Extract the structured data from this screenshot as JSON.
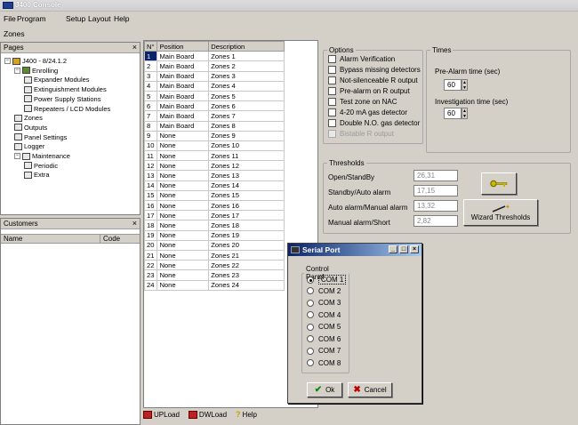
{
  "window": {
    "title": "J400 Console"
  },
  "menu": [
    "File",
    "Program",
    "Setup",
    "Layout",
    "Help"
  ],
  "toolbar": {
    "section": "Zones"
  },
  "pages_panel": {
    "title": "Pages",
    "close": "×",
    "tree": [
      {
        "label": "J400 - 8/24.1.2",
        "depth": 0,
        "expander": "−",
        "icon": "server-icon"
      },
      {
        "label": "Enrolling",
        "depth": 1,
        "expander": "−",
        "icon": "enrolling-icon"
      },
      {
        "label": "Expander Modules",
        "depth": 2,
        "icon": "expander-icon"
      },
      {
        "label": "Extinguishment Modules",
        "depth": 2,
        "icon": "extinguish-icon"
      },
      {
        "label": "Power Supply Stations",
        "depth": 2,
        "icon": "power-icon"
      },
      {
        "label": "Repeaters / LCD Modules",
        "depth": 2,
        "icon": "lcd-icon"
      },
      {
        "label": "Zones",
        "depth": 1,
        "icon": "zones-icon"
      },
      {
        "label": "Outputs",
        "depth": 1,
        "icon": "bell-icon"
      },
      {
        "label": "Panel Settings",
        "depth": 1,
        "icon": "settings-icon"
      },
      {
        "label": "Logger",
        "depth": 1,
        "icon": "logger-icon"
      },
      {
        "label": "Maintenance",
        "depth": 1,
        "expander": "−",
        "icon": "maintenance-icon"
      },
      {
        "label": "Periodic",
        "depth": 2,
        "icon": "periodic-icon"
      },
      {
        "label": "Extra",
        "depth": 2,
        "icon": "wrench-icon"
      }
    ]
  },
  "customers_panel": {
    "title": "Customers",
    "close": "×",
    "columns": [
      "Name",
      "Code"
    ]
  },
  "zones_table": {
    "columns": [
      "N°",
      "Position",
      "Description"
    ],
    "rows": [
      [
        "1",
        "Main Board",
        "Zones 1"
      ],
      [
        "2",
        "Main Board",
        "Zones 2"
      ],
      [
        "3",
        "Main Board",
        "Zones 3"
      ],
      [
        "4",
        "Main Board",
        "Zones 4"
      ],
      [
        "5",
        "Main Board",
        "Zones 5"
      ],
      [
        "6",
        "Main Board",
        "Zones 6"
      ],
      [
        "7",
        "Main Board",
        "Zones 7"
      ],
      [
        "8",
        "Main Board",
        "Zones 8"
      ],
      [
        "9",
        "None",
        "Zones 9"
      ],
      [
        "10",
        "None",
        "Zones 10"
      ],
      [
        "11",
        "None",
        "Zones 11"
      ],
      [
        "12",
        "None",
        "Zones 12"
      ],
      [
        "13",
        "None",
        "Zones 13"
      ],
      [
        "14",
        "None",
        "Zones 14"
      ],
      [
        "15",
        "None",
        "Zones 15"
      ],
      [
        "16",
        "None",
        "Zones 16"
      ],
      [
        "17",
        "None",
        "Zones 17"
      ],
      [
        "18",
        "None",
        "Zones 18"
      ],
      [
        "19",
        "None",
        "Zones 19"
      ],
      [
        "20",
        "None",
        "Zones 20"
      ],
      [
        "21",
        "None",
        "Zones 21"
      ],
      [
        "22",
        "None",
        "Zones 22"
      ],
      [
        "23",
        "None",
        "Zones 23"
      ],
      [
        "24",
        "None",
        "Zones 24"
      ]
    ]
  },
  "options": {
    "legend": "Options",
    "items": [
      {
        "label": "Alarm Verification",
        "checked": false,
        "disabled": false
      },
      {
        "label": "Bypass missing detectors",
        "checked": false,
        "disabled": false
      },
      {
        "label": "Not-silenceable R output",
        "checked": false,
        "disabled": false
      },
      {
        "label": "Pre-alarm on R output",
        "checked": false,
        "disabled": false
      },
      {
        "label": "Test zone on NAC",
        "checked": false,
        "disabled": false
      },
      {
        "label": "4-20 mA gas detector",
        "checked": false,
        "disabled": false
      },
      {
        "label": "Double N.O. gas detector",
        "checked": false,
        "disabled": false
      },
      {
        "label": "Bistable R output",
        "checked": false,
        "disabled": true
      }
    ]
  },
  "times": {
    "legend": "Times",
    "prealarm_label": "Pre-Alarm time (sec)",
    "prealarm_value": "60",
    "investigation_label": "Investigation time (sec)",
    "investigation_value": "60"
  },
  "thresholds": {
    "legend": "Thresholds",
    "rows": [
      {
        "label": "Open/StandBy",
        "value": "26,31"
      },
      {
        "label": "Standby/Auto alarm",
        "value": "17,15"
      },
      {
        "label": "Auto alarm/Manual alarm",
        "value": "13,32"
      },
      {
        "label": "Manual alarm/Short",
        "value": "2,82"
      }
    ],
    "wizard_label": "Wizard Thresholds"
  },
  "serial_dialog": {
    "title": "Serial Port",
    "group": "Control Panel",
    "ports": [
      "COM 1",
      "COM 2",
      "COM 3",
      "COM 4",
      "COM 5",
      "COM 6",
      "COM 7",
      "COM 8"
    ],
    "selected": "COM 1",
    "ok": "Ok",
    "cancel": "Cancel"
  },
  "bottom": {
    "upload": "UPLoad",
    "download": "DWLoad",
    "help": "Help"
  }
}
